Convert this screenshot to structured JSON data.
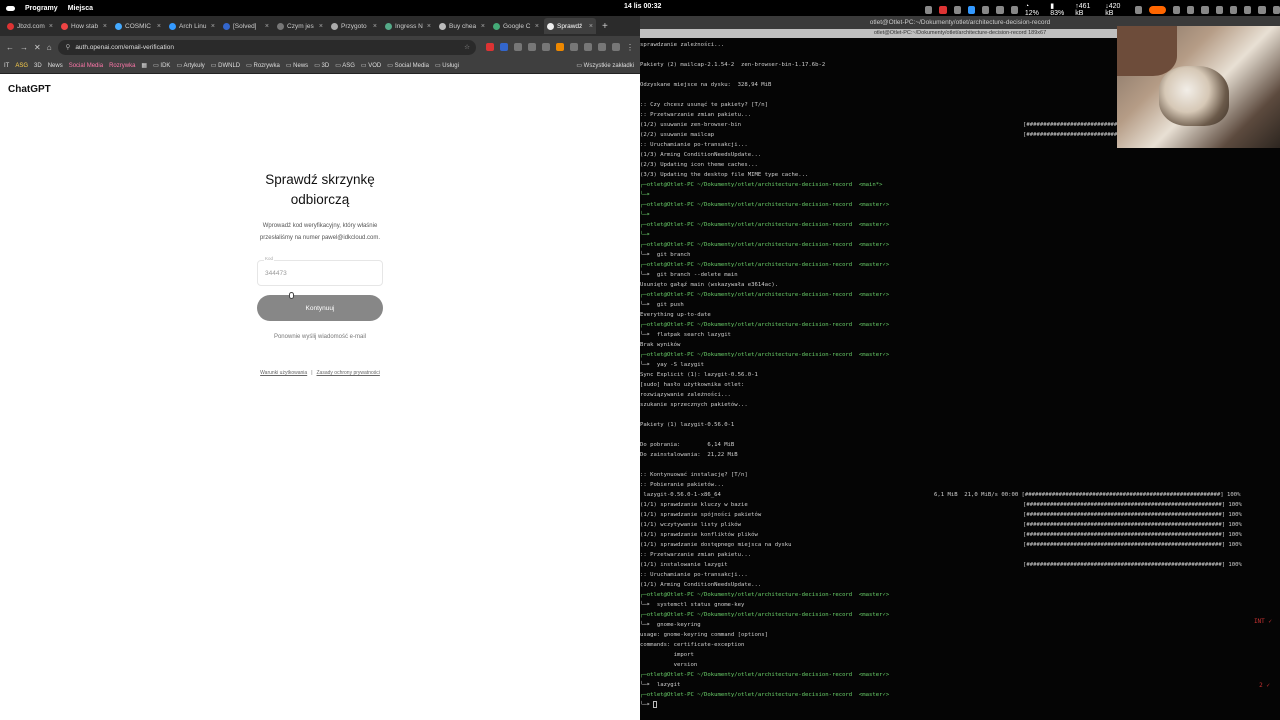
{
  "system_bar": {
    "menu": [
      "Programy",
      "Miejsca"
    ],
    "clock": "14 lis 00:32",
    "tray": {
      "cpu": "12%",
      "battery": "83%",
      "net_up": "461 kB",
      "net_down": "420 kB"
    }
  },
  "browser": {
    "tabs": [
      {
        "label": "Jbzd.com",
        "active": false
      },
      {
        "label": "How stab",
        "active": false
      },
      {
        "label": "COSMIC",
        "active": false
      },
      {
        "label": "Arch Linu",
        "active": false
      },
      {
        "label": "[Solved]",
        "active": false
      },
      {
        "label": "Czym jes",
        "active": false
      },
      {
        "label": "Przygoto",
        "active": false
      },
      {
        "label": "Ingress N",
        "active": false
      },
      {
        "label": "Buy chea",
        "active": false
      },
      {
        "label": "Google C",
        "active": false
      },
      {
        "label": "Sprawdź",
        "active": true
      }
    ],
    "url": "auth.openai.com/email-verification",
    "bookmarks": [
      "IT",
      "ASG",
      "3D",
      "News",
      "Social Media",
      "Rozrywka",
      "IDK",
      "Artykuły",
      "DWNLD",
      "Rozrywka",
      "News",
      "3D",
      "ASG",
      "VOD",
      "Social Media",
      "Usługi"
    ],
    "bookmarks_right": "Wszystkie zakładki",
    "page": {
      "brand": "ChatGPT",
      "title": "Sprawdź skrzynkę odbiorczą",
      "description": "Wprowadź kod weryfikacyjny, który właśnie przesłaliśmy na numer pawel@idkcloud.com.",
      "code_label": "Kod",
      "code_value": "344473",
      "continue_button": "Kontynuuj",
      "resend": "Ponownie wyślij wiadomość e-mail",
      "terms": "Warunki użytkowania",
      "separator": "|",
      "privacy": "Zasady ochrony prywatności"
    }
  },
  "terminal": {
    "title": "otlet@Otlet-PC:~/Dokumenty/otlet/architecture-decision-record",
    "subtitle": "otlet@Otlet-PC:~/Dokumenty/otlet/architecture-decision-record 189x67",
    "lines": [
      {
        "text": "sprawdzanie zależności...",
        "cls": ""
      },
      {
        "text": "",
        "cls": ""
      },
      {
        "text": "Pakiety (2) mailcap-2.1.54-2  zen-browser-bin-1.17.6b-2",
        "cls": ""
      },
      {
        "text": "",
        "cls": ""
      },
      {
        "text": "Odzyskane miejsce na dysku:  328,94 MiB",
        "cls": ""
      },
      {
        "text": "",
        "cls": ""
      },
      {
        "text": ":: Czy chcesz usunąć te pakiety? [T/n]",
        "cls": ""
      },
      {
        "text": ":: Przetwarzanie zmian pakietu...",
        "cls": ""
      },
      {
        "text": "(1/2) usuwanie zen-browser-bin",
        "cls": "",
        "bar": "[######################################]"
      },
      {
        "text": "(2/2) usuwanie mailcap",
        "cls": "",
        "bar": "[######################################]"
      },
      {
        "text": ":: Uruchamianie po-transakcji...",
        "cls": ""
      },
      {
        "text": "(1/3) Arming ConditionNeedsUpdate...",
        "cls": ""
      },
      {
        "text": "(2/3) Updating icon theme caches...",
        "cls": ""
      },
      {
        "text": "(3/3) Updating the desktop file MIME type cache...",
        "cls": ""
      },
      {
        "text": "┌─otlet@Otlet-PC ~/Dokumenty/otlet/architecture-decision-record  <main*>",
        "cls": "prompt"
      },
      {
        "text": "└─➤",
        "cls": "p-green"
      },
      {
        "text": "┌─otlet@Otlet-PC ~/Dokumenty/otlet/architecture-decision-record  <master✓>",
        "cls": "prompt"
      },
      {
        "text": "└─➤",
        "cls": "p-green"
      },
      {
        "text": "┌─otlet@Otlet-PC ~/Dokumenty/otlet/architecture-decision-record  <master✓>",
        "cls": "prompt"
      },
      {
        "text": "└─➤",
        "cls": "p-green"
      },
      {
        "text": "┌─otlet@Otlet-PC ~/Dokumenty/otlet/architecture-decision-record  <master✓>",
        "cls": "prompt"
      },
      {
        "text": "└─➤  git branch",
        "cls": ""
      },
      {
        "text": "┌─otlet@Otlet-PC ~/Dokumenty/otlet/architecture-decision-record  <master✓>",
        "cls": "prompt"
      },
      {
        "text": "└─➤  git branch --delete main",
        "cls": ""
      },
      {
        "text": "Usunięto gałąź main (wskazywała e3614ac).",
        "cls": ""
      },
      {
        "text": "┌─otlet@Otlet-PC ~/Dokumenty/otlet/architecture-decision-record  <master✓>",
        "cls": "prompt"
      },
      {
        "text": "└─➤  git push",
        "cls": ""
      },
      {
        "text": "Everything up-to-date",
        "cls": ""
      },
      {
        "text": "┌─otlet@Otlet-PC ~/Dokumenty/otlet/architecture-decision-record  <master✓>",
        "cls": "prompt"
      },
      {
        "text": "└─➤  flatpak search lazygit",
        "cls": ""
      },
      {
        "text": "Brak wyników",
        "cls": ""
      },
      {
        "text": "┌─otlet@Otlet-PC ~/Dokumenty/otlet/architecture-decision-record  <master✓>",
        "cls": "prompt"
      },
      {
        "text": "└─➤  yay -S lazygit",
        "cls": ""
      },
      {
        "text": "Sync Explicit (1): lazygit-0.56.0-1",
        "cls": ""
      },
      {
        "text": "[sudo] hasło użytkownika otlet:",
        "cls": ""
      },
      {
        "text": "rozwiązywanie zależności...",
        "cls": ""
      },
      {
        "text": "szukanie sprzecznych pakietów...",
        "cls": ""
      },
      {
        "text": "",
        "cls": ""
      },
      {
        "text": "Pakiety (1) lazygit-0.56.0-1",
        "cls": ""
      },
      {
        "text": "",
        "cls": ""
      },
      {
        "text": "Do pobrania:        6,14 MiB",
        "cls": ""
      },
      {
        "text": "Do zainstalowania:  21,22 MiB",
        "cls": ""
      },
      {
        "text": "",
        "cls": ""
      },
      {
        "text": ":: Kontynuować instalację? [T/n]",
        "cls": ""
      },
      {
        "text": ":: Pobieranie pakietów...",
        "cls": ""
      },
      {
        "text": " lazygit-0.56.0-1-x86_64",
        "cls": "",
        "bar": "6,1 MiB  21,0 MiB/s 00:00 [##########################################################] 100%"
      },
      {
        "text": "(1/1) sprawdzanie kluczy w bazie",
        "cls": "",
        "bar": "[##########################################################] 100%"
      },
      {
        "text": "(1/1) sprawdzanie spójności pakietów",
        "cls": "",
        "bar": "[##########################################################] 100%"
      },
      {
        "text": "(1/1) wczytywanie listy plików",
        "cls": "",
        "bar": "[##########################################################] 100%"
      },
      {
        "text": "(1/1) sprawdzanie konfliktów plików",
        "cls": "",
        "bar": "[##########################################################] 100%"
      },
      {
        "text": "(1/1) sprawdzanie dostępnego miejsca na dysku",
        "cls": "",
        "bar": "[##########################################################] 100%"
      },
      {
        "text": ":: Przetwarzanie zmian pakietu...",
        "cls": ""
      },
      {
        "text": "(1/1) instalowanie lazygit",
        "cls": "",
        "bar": "[##########################################################] 100%"
      },
      {
        "text": ":: Uruchamianie po-transakcji...",
        "cls": ""
      },
      {
        "text": "(1/1) Arming ConditionNeedsUpdate...",
        "cls": ""
      },
      {
        "text": "┌─otlet@Otlet-PC ~/Dokumenty/otlet/architecture-decision-record  <master✓>",
        "cls": "prompt"
      },
      {
        "text": "└─➤  systemctl status gnome-key",
        "cls": ""
      },
      {
        "text": "┌─otlet@Otlet-PC ~/Dokumenty/otlet/architecture-decision-record  <master✓>",
        "cls": "prompt"
      },
      {
        "text": "└─➤  gnome-keyring",
        "cls": ""
      },
      {
        "text": "usage: gnome-keyring command [options]",
        "cls": ""
      },
      {
        "text": "commands: certificate-exception",
        "cls": ""
      },
      {
        "text": "          import",
        "cls": ""
      },
      {
        "text": "          version",
        "cls": ""
      },
      {
        "text": "┌─otlet@Otlet-PC ~/Dokumenty/otlet/architecture-decision-record  <master✓>",
        "cls": "prompt"
      },
      {
        "text": "└─➤  lazygit",
        "cls": ""
      },
      {
        "text": "┌─otlet@Otlet-PC ~/Dokumenty/otlet/architecture-decision-record  <master✓>",
        "cls": "prompt"
      },
      {
        "text": "└─➤ ",
        "cls": "caret-line"
      }
    ],
    "red_corner_1": "INT ✓",
    "red_corner_2": "2 ✓"
  }
}
